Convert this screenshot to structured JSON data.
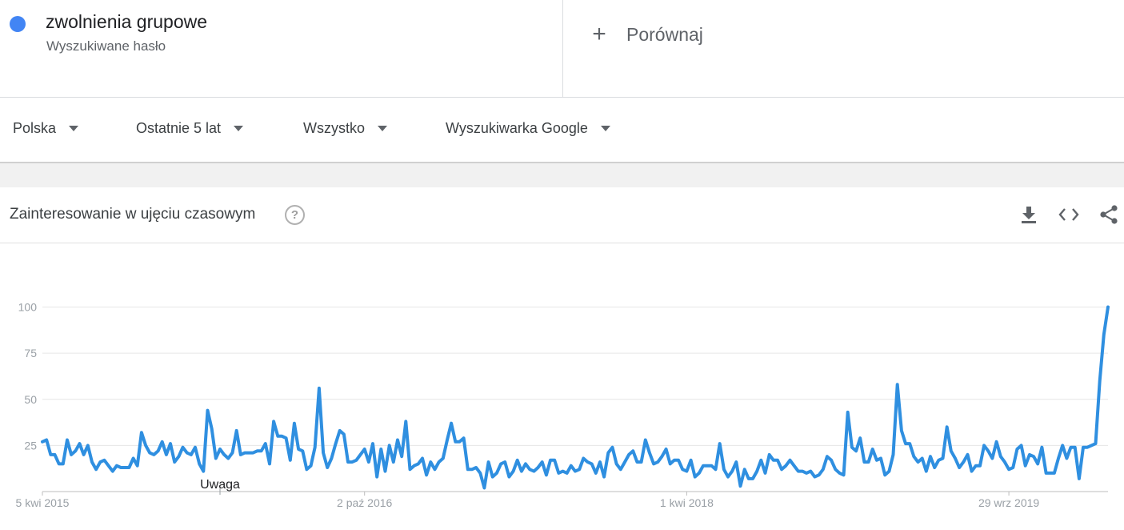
{
  "term": {
    "name": "zwolnienia grupowe",
    "subtitle": "Wyszukiwane hasło",
    "color": "#4285f4"
  },
  "compare": {
    "label": "Porównaj",
    "icon": "plus-icon"
  },
  "filters": {
    "region": "Polska",
    "period": "Ostatnie 5 lat",
    "category": "Wszystko",
    "source": "Wyszukiwarka Google"
  },
  "card": {
    "title": "Zainteresowanie w ujęciu czasowym",
    "help_icon": "help-circle-icon",
    "download_icon": "download-icon",
    "embed_icon": "embed-code-icon",
    "share_icon": "share-icon"
  },
  "chart_data": {
    "type": "line",
    "title": "",
    "xlabel": "",
    "ylabel": "",
    "ylim": [
      0,
      100
    ],
    "yticks": [
      25,
      50,
      75,
      100
    ],
    "grid": true,
    "line_color": "#2f8fe0",
    "x_tick_labels": [
      "5 kwi 2015",
      "2 paź 2016",
      "1 kwi 2018",
      "29 wrz 2019"
    ],
    "x_tick_index": [
      0,
      78,
      156,
      234
    ],
    "annotation": {
      "label": "Uwaga",
      "index": 43
    },
    "series": [
      {
        "values": [
          27,
          28,
          20,
          20,
          15,
          15,
          28,
          20,
          22,
          26,
          20,
          25,
          16,
          12,
          16,
          17,
          14,
          11,
          14,
          13,
          13,
          13,
          18,
          14,
          32,
          25,
          21,
          20,
          22,
          27,
          20,
          26,
          16,
          19,
          24,
          21,
          20,
          24,
          15,
          11,
          44,
          34,
          18,
          23,
          20,
          18,
          21,
          33,
          20,
          21,
          21,
          21,
          22,
          22,
          26,
          15,
          38,
          30,
          30,
          29,
          17,
          37,
          23,
          22,
          12,
          14,
          24,
          56,
          21,
          13,
          18,
          26,
          33,
          31,
          16,
          16,
          17,
          20,
          23,
          16,
          26,
          8,
          23,
          11,
          25,
          16,
          28,
          19,
          38,
          12,
          14,
          15,
          18,
          9,
          16,
          12,
          16,
          18,
          28,
          37,
          27,
          27,
          29,
          12,
          12,
          13,
          10,
          2,
          16,
          8,
          10,
          15,
          16,
          8,
          11,
          17,
          11,
          15,
          12,
          11,
          13,
          16,
          9,
          17,
          17,
          10,
          11,
          10,
          14,
          11,
          12,
          18,
          16,
          15,
          10,
          16,
          8,
          21,
          24,
          15,
          12,
          16,
          20,
          22,
          16,
          16,
          28,
          21,
          15,
          16,
          19,
          23,
          15,
          17,
          17,
          12,
          11,
          17,
          8,
          10,
          14,
          14,
          14,
          12,
          26,
          12,
          8,
          11,
          16,
          3,
          12,
          7,
          7,
          11,
          17,
          10,
          20,
          17,
          17,
          12,
          14,
          17,
          14,
          11,
          11,
          10,
          11,
          8,
          9,
          12,
          19,
          17,
          12,
          10,
          9,
          43,
          24,
          22,
          29,
          16,
          16,
          23,
          17,
          18,
          9,
          11,
          20,
          58,
          33,
          26,
          26,
          19,
          16,
          18,
          11,
          19,
          13,
          17,
          18,
          35,
          22,
          18,
          13,
          16,
          20,
          11,
          14,
          14,
          25,
          22,
          18,
          27,
          19,
          16,
          12,
          13,
          23,
          25,
          14,
          20,
          19,
          15,
          24,
          10,
          10,
          10,
          18,
          25,
          18,
          24,
          24,
          7,
          24,
          24,
          25,
          26,
          60,
          85,
          100
        ]
      }
    ]
  }
}
